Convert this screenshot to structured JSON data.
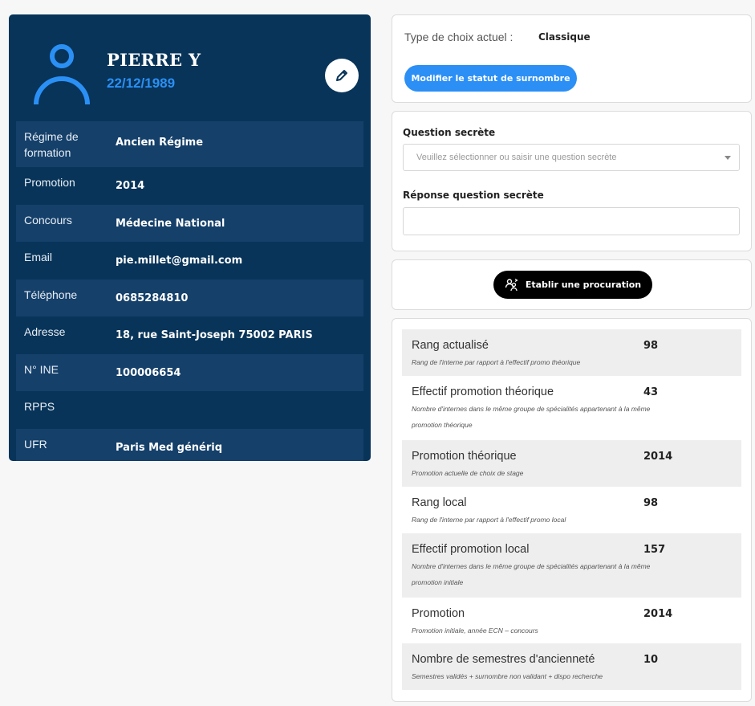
{
  "profile": {
    "name": "PIERRE Y",
    "dob": "22/12/1989",
    "rows": [
      {
        "label": "Régime de formation",
        "value": "Ancien Régime"
      },
      {
        "label": "Promotion",
        "value": "2014"
      },
      {
        "label": "Concours",
        "value": "Médecine National"
      },
      {
        "label": "Email",
        "value": "pie.millet@gmail.com"
      },
      {
        "label": "Téléphone",
        "value": "0685284810"
      },
      {
        "label": "Adresse",
        "value": "18, rue Saint-Joseph 75002 PARIS"
      },
      {
        "label": "N° INE",
        "value": "100006654"
      },
      {
        "label": "RPPS",
        "value": ""
      },
      {
        "label": "UFR",
        "value": "Paris Med génériq"
      }
    ]
  },
  "choice": {
    "label": "Type de choix actuel :",
    "value": "Classique",
    "button": "Modifier le statut de surnombre"
  },
  "secret": {
    "question_title": "Question secrète",
    "question_placeholder": "Veuillez sélectionner ou saisir une question secrète",
    "answer_title": "Réponse question secrète",
    "answer_value": ""
  },
  "proxy": {
    "button": "Etablir une procuration"
  },
  "stats": [
    {
      "title": "Rang actualisé",
      "desc": "Rang de l'interne par rapport à l'effectif promo théorique",
      "value": "98"
    },
    {
      "title": "Effectif promotion théorique",
      "desc": "Nombre d'internes dans le même groupe de spécialités appartenant à la même promotion théorique",
      "value": "43"
    },
    {
      "title": "Promotion théorique",
      "desc": "Promotion actuelle de choix de stage",
      "value": "2014"
    },
    {
      "title": "Rang local",
      "desc": "Rang de l'interne par rapport à l'effectif promo local",
      "value": "98"
    },
    {
      "title": "Effectif promotion local",
      "desc": "Nombre d'internes dans le même groupe de spécialités appartenant à la même promotion initiale",
      "value": "157"
    },
    {
      "title": "Promotion",
      "desc": "Promotion initiale, année ECN – concours",
      "value": "2014"
    },
    {
      "title": "Nombre de semestres d'ancienneté",
      "desc": "Semestres validés + surnombre non validant + dispo recherche",
      "value": "10"
    }
  ],
  "colors": {
    "card": "#083459",
    "row_shade": "#15406a",
    "accent": "#2b8ff5"
  },
  "icons": {
    "avatar": "user-icon",
    "edit": "pencil-icon",
    "proxy": "users-exchange-icon",
    "select": "chevron-down-icon"
  }
}
